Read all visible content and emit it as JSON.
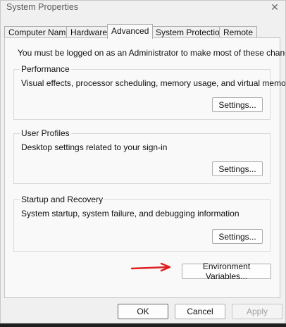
{
  "window": {
    "title": "System Properties",
    "close_glyph": "✕"
  },
  "tabs": [
    {
      "label": "Computer Name",
      "active": false
    },
    {
      "label": "Hardware",
      "active": false
    },
    {
      "label": "Advanced",
      "active": true
    },
    {
      "label": "System Protection",
      "active": false
    },
    {
      "label": "Remote",
      "active": false
    }
  ],
  "advanced": {
    "notice": "You must be logged on as an Administrator to make most of these changes.",
    "performance": {
      "title": "Performance",
      "description": "Visual effects, processor scheduling, memory usage, and virtual memory",
      "button": "Settings..."
    },
    "user_profiles": {
      "title": "User Profiles",
      "description": "Desktop settings related to your sign-in",
      "button": "Settings..."
    },
    "startup_recovery": {
      "title": "Startup and Recovery",
      "description": "System startup, system failure, and debugging information",
      "button": "Settings..."
    },
    "environment_button": "Environment Variables..."
  },
  "footer": {
    "ok": "OK",
    "cancel": "Cancel",
    "apply": "Apply"
  },
  "colors": {
    "annotation_arrow": "#e02020"
  }
}
